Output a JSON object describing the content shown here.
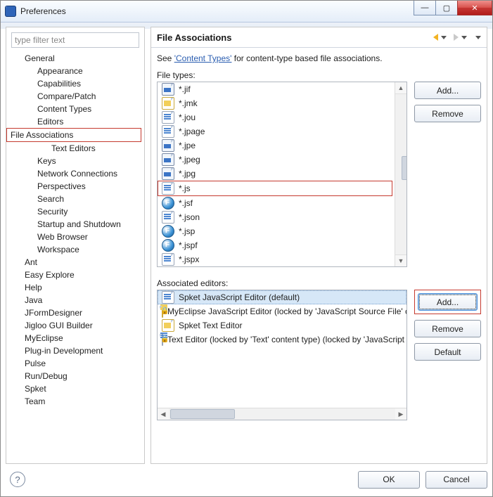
{
  "window": {
    "title": "Preferences"
  },
  "filter_placeholder": "type filter text",
  "tree": {
    "items": [
      {
        "label": "General",
        "depth": 1
      },
      {
        "label": "Appearance",
        "depth": 2
      },
      {
        "label": "Capabilities",
        "depth": 2
      },
      {
        "label": "Compare/Patch",
        "depth": 2
      },
      {
        "label": "Content Types",
        "depth": 2
      },
      {
        "label": "Editors",
        "depth": 2
      },
      {
        "label": "File Associations",
        "depth": 3,
        "selected": true
      },
      {
        "label": "Text Editors",
        "depth": 3
      },
      {
        "label": "Keys",
        "depth": 2
      },
      {
        "label": "Network Connections",
        "depth": 2
      },
      {
        "label": "Perspectives",
        "depth": 2
      },
      {
        "label": "Search",
        "depth": 2
      },
      {
        "label": "Security",
        "depth": 2
      },
      {
        "label": "Startup and Shutdown",
        "depth": 2
      },
      {
        "label": "Web Browser",
        "depth": 2
      },
      {
        "label": "Workspace",
        "depth": 2
      },
      {
        "label": "Ant",
        "depth": 1
      },
      {
        "label": "Easy Explore",
        "depth": 1
      },
      {
        "label": "Help",
        "depth": 1
      },
      {
        "label": "Java",
        "depth": 1
      },
      {
        "label": "JFormDesigner",
        "depth": 1
      },
      {
        "label": "Jigloo GUI Builder",
        "depth": 1
      },
      {
        "label": "MyEclipse",
        "depth": 1
      },
      {
        "label": "Plug-in Development",
        "depth": 1
      },
      {
        "label": "Pulse",
        "depth": 1
      },
      {
        "label": "Run/Debug",
        "depth": 1
      },
      {
        "label": "Spket",
        "depth": 1
      },
      {
        "label": "Team",
        "depth": 1
      }
    ]
  },
  "page": {
    "title": "File Associations",
    "desc_prefix": "See ",
    "desc_link": "'Content Types'",
    "desc_suffix": " for content-type based file associations.",
    "filetypes_label": "File types:",
    "filetypes": [
      {
        "ext": "*.jif",
        "icon": "blue"
      },
      {
        "ext": "*.jmk",
        "icon": "yellow"
      },
      {
        "ext": "*.jou",
        "icon": "page"
      },
      {
        "ext": "*.jpage",
        "icon": "page"
      },
      {
        "ext": "*.jpe",
        "icon": "blue"
      },
      {
        "ext": "*.jpeg",
        "icon": "blue"
      },
      {
        "ext": "*.jpg",
        "icon": "blue"
      },
      {
        "ext": "*.js",
        "icon": "page",
        "selected": true
      },
      {
        "ext": "*.jsf",
        "icon": "ball"
      },
      {
        "ext": "*.json",
        "icon": "page"
      },
      {
        "ext": "*.jsp",
        "icon": "ball"
      },
      {
        "ext": "*.jspf",
        "icon": "ball"
      },
      {
        "ext": "*.jspx",
        "icon": "page"
      }
    ],
    "ft_add": "Add...",
    "ft_remove": "Remove",
    "assoc_label": "Associated editors:",
    "assoc": [
      {
        "label": "Spket JavaScript Editor (default)",
        "icon": "page",
        "selected": true
      },
      {
        "label": "MyEclipse JavaScript Editor (locked by 'JavaScript Source File' content type)",
        "icon": "yellow",
        "locked": true
      },
      {
        "label": "Spket Text Editor",
        "icon": "yellow"
      },
      {
        "label": "Text Editor (locked by 'Text' content type) (locked by 'JavaScript Source File' content type)",
        "icon": "page",
        "locked": true
      }
    ],
    "ae_add": "Add...",
    "ae_remove": "Remove",
    "ae_default": "Default"
  },
  "buttons": {
    "ok": "OK",
    "cancel": "Cancel"
  }
}
